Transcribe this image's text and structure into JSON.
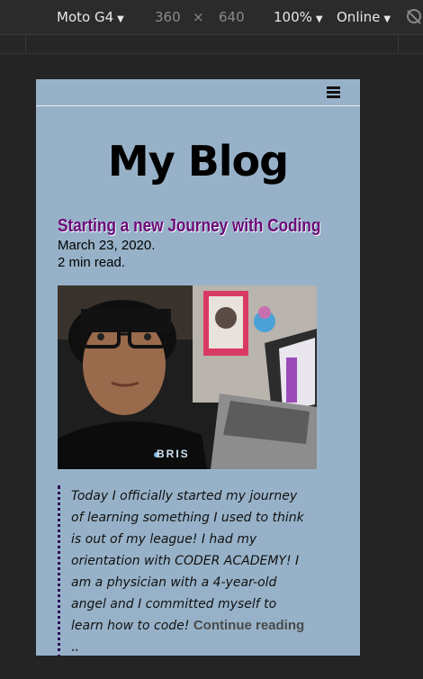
{
  "devtools": {
    "device": "Moto G4",
    "width": "360",
    "times": "×",
    "height": "640",
    "zoom": "100%",
    "network": "Online"
  },
  "page": {
    "blog_title": "My Blog",
    "post": {
      "title": "Starting a new Journey with Coding",
      "date": "March 23, 2020.",
      "read_time": "2 min read.",
      "image_text": "BRIS",
      "excerpt": "Today I officially started my journey of learning something I used to think is out of my league! I had my orientation with CODER ACADEMY! I am a physician with a 4-year-old angel and I committed myself to learn how to code!",
      "continue_label": "Continue reading .."
    }
  },
  "colors": {
    "page_bg": "#97b2c8",
    "title_color": "#6c0a78",
    "devtools_bg": "#2b2b2b"
  }
}
